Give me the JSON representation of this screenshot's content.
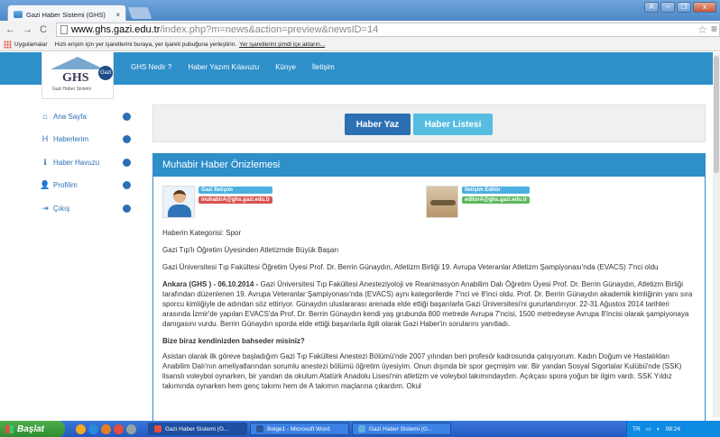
{
  "browser": {
    "tab_title": "Gazi Haber Sistemi (GHS)",
    "tab_close": "×",
    "window_controls": [
      "A",
      "–",
      "❐",
      "x"
    ],
    "url_host": "www.ghs.gazi.edu.tr",
    "url_path": "/index.php?m=news&action=preview&newsID=14",
    "bookmarks_apps": "Uygulamalar",
    "bookmarks_hint": "Hızlı erişim için yer işaretlerini buraya, yer işareti pubuğuna yerleştirin.",
    "bookmarks_link": "Yer işaretlerini şimdi içe aktarın..."
  },
  "site": {
    "logo_text": "GHS",
    "logo_sub": "Gazi Haber Sistemi",
    "logo_badge": "Gazi",
    "menu": [
      "GHS Nedir ?",
      "Haber Yazım Kılavuzu",
      "Künye",
      "İletişim"
    ]
  },
  "sidebar": {
    "items": [
      {
        "label": "Ana Sayfa",
        "icon": "home-icon",
        "glyph": "⌂"
      },
      {
        "label": "Haberlerim",
        "icon": "h-icon",
        "glyph": "H"
      },
      {
        "label": "Haber Havuzu",
        "icon": "info-icon",
        "glyph": "ℹ"
      },
      {
        "label": "Profilim",
        "icon": "user-icon",
        "glyph": "👤"
      },
      {
        "label": "Çıkış",
        "icon": "logout-icon",
        "glyph": "⇥"
      }
    ]
  },
  "actions": {
    "write_label": "Haber Yaz",
    "list_label": "Haber Listesi"
  },
  "panel": {
    "title": "Muhabir Haber Önizlemesi",
    "reporter_tag": "Gazi İletişim",
    "reporter_email": "muhabirA@ghs.gazi.edu.tr",
    "editor_tag": "İletişim Editör",
    "editor_email": "editorA@ghs.gazi.edu.tr"
  },
  "article": {
    "category": "Haberin Kategorisi: Spor",
    "headline": "Gazi Tıp'lı Öğretim Üyesinden Atletizmde Büyük Başarı",
    "summary": "Gazi Üniversitesi Tıp Fakültesi Öğretim Üyesi Prof. Dr. Berrin Günaydın, Atletizm Birliği 19. Avrupa Veteranlar Atletizm Şampiyonası'nda (EVACS) 7'nci oldu",
    "dateline": "Ankara (GHS ) - 06.10.2014 -",
    "body": " Gazi Üniversitesi Tıp Fakültesi Anesteziyoloji ve Reanimasyon Anabilim Dalı Öğretim Üyesi Prof. Dr. Berrin Günaydın, Atletizm Birliği tarafından düzenlenen 19. Avrupa Veteranlar Şampiyonası'nda (EVACS) aynı kategorilerde 7'nci ve 8'inci oldu. Prof. Dr. Berrin Günaydın akademik kimliğinin yanı sıra sporcu kimliğiyle de adından söz ettiriyor. Günaydın uluslararası arenada elde ettiği başarılarla Gazi Üniversitesi'ni gururlandırıyor. 22-31 Ağustos 2014 tarihleri arasında İzmir'de yapılan EVACS'da Prof. Dr. Berrin Günaydın kendi yaş grubunda 800 metrede Avrupa 7'ncisi, 1500 metredeyse Avrupa 8'incisi olarak şampiyonaya damgasını vurdu. Berrin Günaydın sporda elde ettiği başarılarla ilgili olarak Gazi Haber'in sorularını yanıtladı.",
    "question": "Bize biraz kendinizden bahseder misiniz?",
    "answer": "Asistan olarak ilk göreve başladığım Gazi Tıp Fakültesi Anestezi Bölümü'nde 2007 yılından beri profesör kadrosunda çalışıyorum. Kadın Doğum ve Hastalıkları Anabilim Dalı'nın ameliyatlarından sorumlu anestezi bölümü öğretim üyesiyim. Onun dışında bir spor geçmişim var. Bir yandan Sosyal Sigortalar Kulübü'nde (SSK) lisanslı voleybol oynarken, bir yandan da okulum Atatürk Anadolu Lisesi'nin atletizm ve voleybol takımındaydım. Açıkçası spora yoğun bir ilgim vardı. SSK Yıldız takımında oynarken hem genç takımı hem de A takımın maçlarına çıkardım. Okul"
  },
  "taskbar": {
    "start_label": "Başlat",
    "tasks": [
      "Gazi Haber Sistemi (G...",
      "Belge1 - Microsoft Word",
      "Gazi Haber Sistemi (G..."
    ],
    "lang": "TR",
    "clock": "08:24"
  }
}
